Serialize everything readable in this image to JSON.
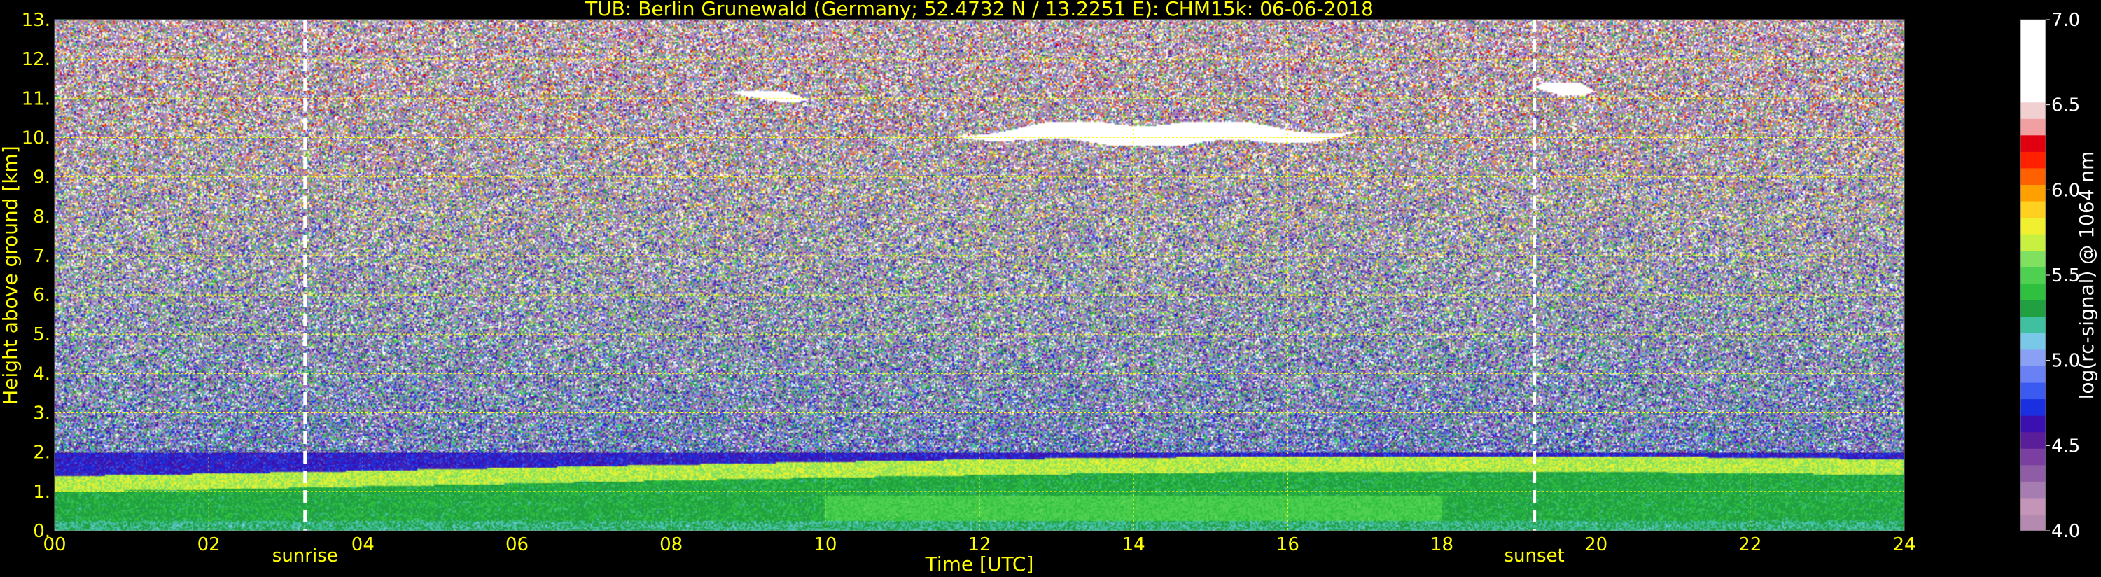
{
  "chart_data": {
    "type": "heatmap",
    "title": "TUB: Berlin Grunewald (Germany; 52.4732 N / 13.2251 E):    CHM15k: 06-06-2018",
    "xlabel": "Time [UTC]",
    "ylabel": "Height above ground [km]",
    "x_ticks": [
      "00",
      "02",
      "04",
      "06",
      "08",
      "10",
      "12",
      "14",
      "16",
      "18",
      "20",
      "22",
      "24"
    ],
    "x_range": [
      0,
      24
    ],
    "y_ticks": [
      "0.",
      "1.",
      "2.",
      "3.",
      "4.",
      "5.",
      "6.",
      "7.",
      "8.",
      "9.",
      "10.",
      "11.",
      "12.",
      "13."
    ],
    "y_range": [
      0,
      13
    ],
    "grid": true,
    "grid_color": "#ffff00",
    "markers": [
      {
        "label": "sunrise",
        "time_h": 3.25
      },
      {
        "label": "sunset",
        "time_h": 19.2
      }
    ],
    "colorbar": {
      "label": "log(rc-signal) @ 1064 nm",
      "ticks": [
        "4.0",
        "4.5",
        "5.0",
        "5.5",
        "6.0",
        "6.5",
        "7.0"
      ],
      "range": [
        4.0,
        7.0
      ],
      "colors": [
        "#b48ab0",
        "#c594b9",
        "#a67db1",
        "#8e5da6",
        "#7a3fa0",
        "#5a1e9a",
        "#3a10b0",
        "#1a30e0",
        "#3a5af0",
        "#6a80f5",
        "#8aa0f5",
        "#7ac8e8",
        "#40c0a0",
        "#20a040",
        "#30c040",
        "#50d050",
        "#80e060",
        "#c8f040",
        "#f0f030",
        "#ffd020",
        "#ffa000",
        "#ff6000",
        "#ff2000",
        "#e00010",
        "#f0a0a0",
        "#f0d0d0",
        "#ffffff",
        "#ffffff",
        "#ffffff",
        "#ffffff",
        "#ffffff"
      ],
      "colors_end_value": 7.0
    },
    "features": [
      {
        "name": "boundary layer aerosol",
        "height_km": [
          0.0,
          1.9
        ],
        "time_h": [
          0,
          24
        ]
      },
      {
        "name": "cirrus cloud",
        "height_km": [
          9.8,
          10.4
        ],
        "time_h": [
          11.7,
          16.9
        ]
      },
      {
        "name": "cirrus cloud",
        "height_km": [
          10.9,
          11.2
        ],
        "time_h": [
          8.8,
          9.8
        ]
      },
      {
        "name": "cirrus cloud",
        "height_km": [
          11.0,
          11.4
        ],
        "time_h": [
          19.2,
          20.0
        ]
      }
    ]
  }
}
